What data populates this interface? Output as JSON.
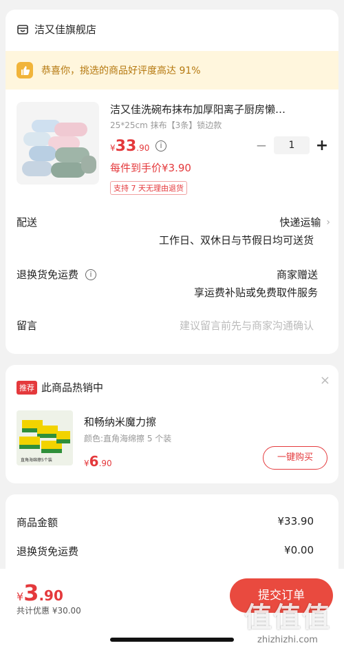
{
  "shop": {
    "name": "洁又佳旗舰店",
    "icon": "shop-icon"
  },
  "praise": {
    "text": "恭喜你，挑选的商品好评度高达 91%",
    "icon": "thumbs-up-icon"
  },
  "product": {
    "title": "洁又佳洗碗布抹布加厚阳离子厨房懒…",
    "spec": "25*25cm 抹布【3条】锁边款",
    "price_symbol": "¥",
    "price_int": "33",
    "price_dec": ".90",
    "unit_price": "每件到手价¥3.90",
    "quantity": "1",
    "tag": "支持 7 天无理由退货",
    "minus_label": "−",
    "plus_label": "+"
  },
  "delivery": {
    "label": "配送",
    "method": "快递运输",
    "detail": "工作日、双休日与节假日均可送货"
  },
  "return_shipping": {
    "label": "退换货免运费",
    "value": "商家赠送",
    "detail": "享运费补贴或免费取件服务"
  },
  "message": {
    "label": "留言",
    "placeholder": "建议留言前先与商家沟通确认"
  },
  "recommend": {
    "badge": "推荐",
    "title": "此商品热销中",
    "close": "×",
    "item_name": "和畅纳米魔力擦",
    "item_spec": "颜色:直角海绵擦 5 个装",
    "price_symbol": "¥",
    "price_int": "6",
    "price_dec": ".90",
    "buy_label": "一键购买",
    "image_caption": "直角海绵擦5个装"
  },
  "summary": {
    "goods_label": "商品金额",
    "goods_value": "¥33.90",
    "shipping_label": "退换货免运费",
    "shipping_value": "¥0.00"
  },
  "footer": {
    "price_symbol": "¥",
    "price_int": "3",
    "price_dec": ".90",
    "discount": "共计优惠 ¥30.00",
    "submit_label": "提交订单"
  },
  "watermark": {
    "text": "值值值",
    "domain": "zhizhizhi.com"
  },
  "colors": {
    "accent": "#e4393c",
    "banner_bg": "#fff6dd",
    "banner_text": "#b5780f"
  }
}
